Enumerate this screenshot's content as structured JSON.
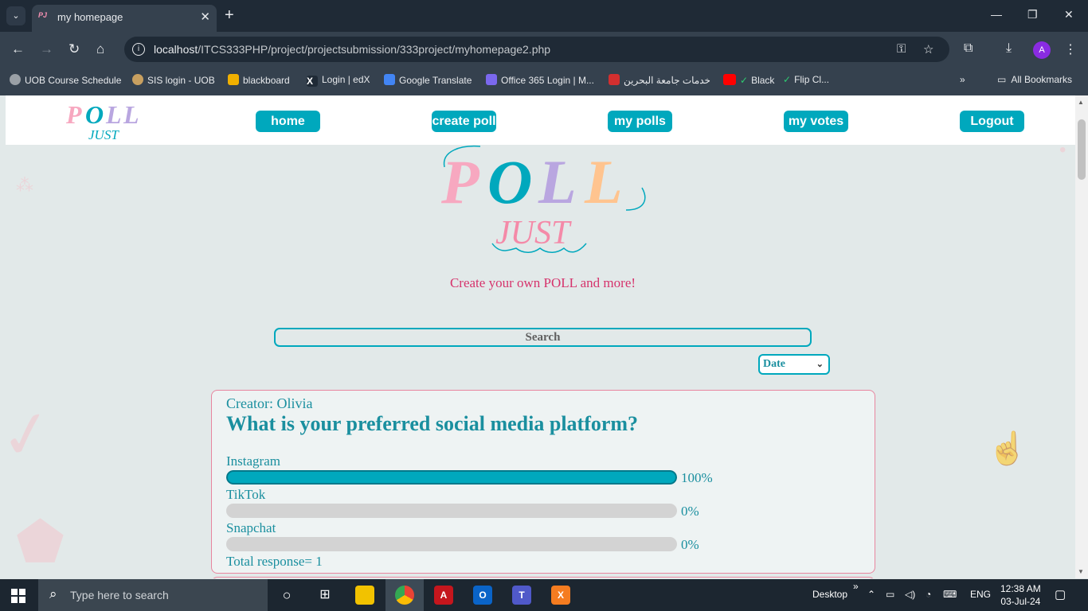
{
  "browser": {
    "tab_title": "my homepage",
    "tab_close": "✕",
    "new_tab": "+",
    "url_host": "localhost",
    "url_path": "/ITCS333PHP/project/projectsubmission/333project/myhomepage2.php",
    "avatar_letter": "A",
    "bookmarks": [
      {
        "label": "UOB Course Schedule",
        "color": "#9aa0a6"
      },
      {
        "label": "SIS login - UOB",
        "color": "#c8a060"
      },
      {
        "label": "blackboard",
        "color": "#f0b000"
      },
      {
        "label": "Login | edX",
        "color": "#ffffff"
      },
      {
        "label": "Google Translate",
        "color": "#4285f4"
      },
      {
        "label": "Office 365 Login | M...",
        "color": "#7b68ee"
      },
      {
        "label": "خدمات جامعة البحرين",
        "color": "#d32f2f"
      },
      {
        "label": "Black",
        "color": "#2ecc71"
      },
      {
        "label": "Flip Cl...",
        "color": "#2ecc71"
      }
    ],
    "all_bookmarks": "All Bookmarks"
  },
  "site": {
    "logo_poll": "POLL",
    "logo_just": "JUST",
    "nav": [
      {
        "label": "home"
      },
      {
        "label": "create poll"
      },
      {
        "label": "my polls"
      },
      {
        "label": "my votes"
      },
      {
        "label": "Logout"
      }
    ],
    "tagline": "Create your own POLL and more!",
    "search_placeholder": "Search",
    "sort_selected": "Date"
  },
  "polls": [
    {
      "creator": "Creator: Olivia",
      "question": "What is your preferred social media platform?",
      "options": [
        {
          "label": "Instagram",
          "percent_text": "100%",
          "fraction": 1.0
        },
        {
          "label": "TikTok",
          "percent_text": "0%",
          "fraction": 0.0
        },
        {
          "label": "Snapchat",
          "percent_text": "0%",
          "fraction": 0.0
        }
      ],
      "total": "Total response= 1"
    }
  ],
  "taskbar": {
    "search_placeholder": "Type here to search",
    "desktop_label": "Desktop",
    "language": "ENG",
    "time": "12:38 AM",
    "date": "03-Jul-24"
  },
  "colors": {
    "accent": "#00a8bd",
    "card_border": "#e8869f",
    "tagline": "#d6336c"
  }
}
